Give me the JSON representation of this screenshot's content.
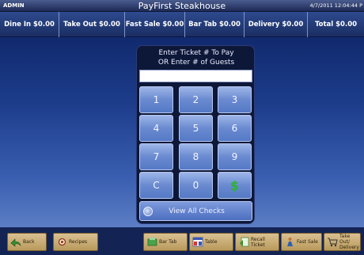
{
  "titlebar": {
    "user": "ADMIN",
    "title": "PayFirst Steakhouse",
    "datetime": "4/7/2011 12:04:44 P"
  },
  "totals": [
    {
      "label": "Dine In $0.00"
    },
    {
      "label": "Take Out $0.00"
    },
    {
      "label": "Fast Sale $0.00"
    },
    {
      "label": "Bar Tab $0.00"
    },
    {
      "label": "Delivery $0.00"
    },
    {
      "label": "Total $0.00"
    }
  ],
  "keypad": {
    "prompt_line1": "Enter Ticket # To Pay",
    "prompt_line2": "OR Enter # of Guests",
    "entry_value": "",
    "keys": [
      "1",
      "2",
      "3",
      "4",
      "5",
      "6",
      "7",
      "8",
      "9",
      "C",
      "0",
      "$"
    ],
    "view_all_label": "View All Checks"
  },
  "bottom_buttons": [
    {
      "label": "Back",
      "icon": "back-arrow-icon"
    },
    {
      "label": "Recipes",
      "icon": "recipes-icon"
    },
    {
      "label": "Bar Tab",
      "icon": "bar-tab-icon"
    },
    {
      "label": "Table",
      "icon": "table-icon"
    },
    {
      "label": "Recall Ticket",
      "icon": "recall-ticket-icon"
    },
    {
      "label": "Fast Sale",
      "icon": "fast-sale-icon"
    },
    {
      "label": "Take Out/ Delivery",
      "icon": "take-out-icon"
    }
  ],
  "colors": {
    "background_top": "#0b1f5e",
    "key_blue": "#6a8ad0",
    "bottom_button": "#d9c091",
    "dollar_green": "#2fae3c"
  }
}
